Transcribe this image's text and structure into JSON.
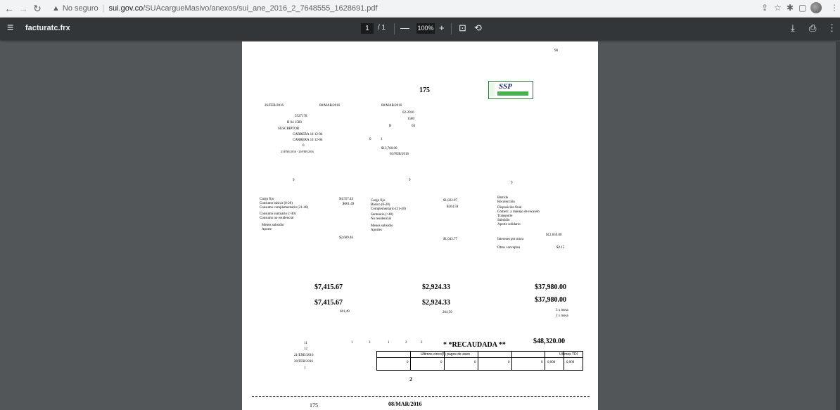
{
  "browser": {
    "security_label": "No seguro",
    "url_host": "sui.gov.co",
    "url_path": "/SUAcargueMasivo/anexos/sui_ane_2016_2_7648555_1628691.pdf"
  },
  "pdf_toolbar": {
    "title": "facturatc.frx",
    "current_page": "1",
    "page_total": "/ 1",
    "zoom": "100%"
  },
  "document": {
    "page_num": "98",
    "code_top": "175",
    "header": {
      "date1": "26/FEB/2016",
      "date2": "08/MAR/2016",
      "account": "5527178",
      "class_line": "B   04   1580",
      "subscriber": "SUSCRIPTOR",
      "address1": "CARRERA 14 12-04",
      "address2": "CARRERA 14 12-04",
      "zero": "0",
      "period": "21/ENE/2016 - 20/FEB/2016",
      "mid_date": "08/MAR/2016",
      "mid_period": "02-2016",
      "mid_code": "1580",
      "mid_b": "B",
      "mid_04": "04",
      "mid_zero": "0",
      "mid_one": "1",
      "mid_amount": "$13,760.00",
      "mid_due": "03/FEB/2016"
    },
    "nines": [
      "9",
      "9",
      "9"
    ],
    "col1": {
      "labels": [
        "Cargo fijo",
        "Consumo básico (0-20)",
        "Consumo complementario (21-40)",
        "Consumo suntuario (>40)",
        "Consumo no residencial",
        "Menos subsidio",
        "Aporte"
      ],
      "v_cargo": "$4,557.44",
      "v_basico": "$661.49",
      "v_aporte": "$2,609.46"
    },
    "col2": {
      "labels": [
        "Cargo fijo",
        "Básico (0-20)",
        "Complementario (21-40)",
        "Suntuario (>40)",
        "No residencial",
        "Menos subsidio",
        "Aportes"
      ],
      "v_cargo": "$1,822.97",
      "v_basico": "$264.59",
      "v_aportes": "$1,043.77"
    },
    "col3": {
      "labels": [
        "Barrido",
        "Recolección",
        "Disposición final",
        "Comerc. y manejo de recaudo",
        "Transporte",
        "Subsidio",
        "Aporte solidario"
      ],
      "intereses_label": "Intereses por mora",
      "otros_label": "Otros conceptos",
      "v_main": "$12,659.00",
      "v_otros": "$2.15"
    },
    "totals": {
      "t1a": "$7,415.67",
      "t2a": "$2,924.33",
      "t3a": "$37,980.00",
      "t1b": "$7,415.67",
      "t2b": "$2,924.33",
      "t3b": "$37,980.00",
      "s1": "661,49",
      "s2": "264,59",
      "times1": "3 x mesa",
      "times2": "2 x mesa"
    },
    "bottom": {
      "n11": "11",
      "n12": "12",
      "date_a": "21/ENE/2016",
      "date_b": "20/FEB/2016",
      "n1": "1",
      "digits": [
        "1",
        "3",
        "1",
        "2",
        "2"
      ],
      "recaudada": "* *RECAUDADA **",
      "grand_total": "$48,320.00",
      "pagos_header": "Ultimos cinco(5) pagos de aseo",
      "tdi_header": "Ultimos TDI",
      "pagos": [
        "0",
        "0",
        "0",
        "0",
        "0"
      ],
      "tdi": [
        "0,000",
        "0,000"
      ],
      "n2": "2"
    },
    "footer": {
      "code": "175",
      "date": "08/MAR/2016"
    }
  }
}
